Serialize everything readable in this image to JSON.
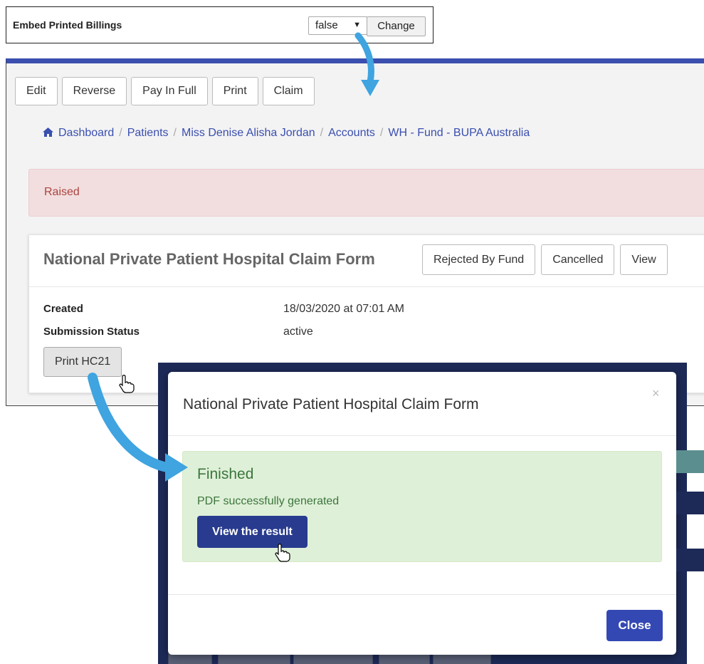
{
  "setting": {
    "label": "Embed Printed Billings",
    "select_value": "false",
    "select_caret": "▼",
    "change_label": "Change"
  },
  "toolbar": {
    "edit": "Edit",
    "reverse": "Reverse",
    "pay_in_full": "Pay In Full",
    "print": "Print",
    "claim": "Claim"
  },
  "breadcrumb": [
    {
      "label": "Dashboard",
      "icon": "home-icon"
    },
    {
      "label": "Patients"
    },
    {
      "label": "Miss Denise Alisha Jordan"
    },
    {
      "label": "Accounts"
    },
    {
      "label": "WH - Fund - BUPA Australia"
    }
  ],
  "breadcrumb_separator": "/",
  "status_alert": "Raised",
  "claim_card": {
    "title": "National Private Patient Hospital Claim Form",
    "rejected_by_fund": "Rejected By Fund",
    "cancelled": "Cancelled",
    "view": "View",
    "created_label": "Created",
    "created_value": "18/03/2020 at 07:01 AM",
    "submission_label": "Submission Status",
    "submission_value": "active",
    "print_button": "Print HC21"
  },
  "modal": {
    "title": "National Private Patient Hospital Claim Form",
    "close_x": "×",
    "success_title": "Finished",
    "success_text": "PDF successfully generated",
    "view_result": "View the result",
    "close_button": "Close"
  },
  "colors": {
    "brand_blue": "#3a4fae",
    "annotation_arrow": "#3fa4e0",
    "modal_primary": "#283b8e"
  }
}
